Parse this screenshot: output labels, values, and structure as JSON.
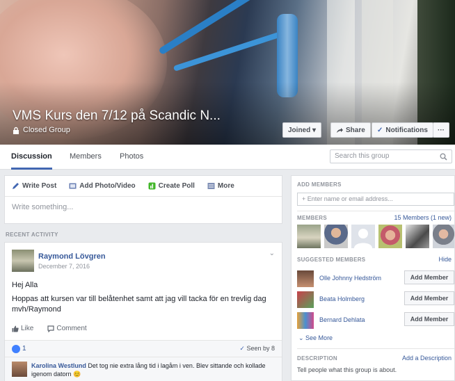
{
  "group": {
    "title": "VMS Kurs den 7/12 på Scandic N...",
    "privacy": "Closed Group",
    "buttons": {
      "joined": "Joined ▾",
      "share": "Share",
      "notifications": "Notifications",
      "more": "···"
    }
  },
  "tabs": [
    "Discussion",
    "Members",
    "Photos"
  ],
  "search": {
    "placeholder": "Search this group"
  },
  "composer": {
    "actions": [
      "Write Post",
      "Add Photo/Video",
      "Create Poll",
      "More"
    ],
    "placeholder": "Write something..."
  },
  "recent_activity_label": "RECENT ACTIVITY",
  "post": {
    "author": "Raymond Lövgren",
    "date": "December 7, 2016",
    "greeting": "Hej Alla",
    "body_line1": "Hoppas att kursen var till belåtenhet samt att jag vill tacka för en trevlig dag",
    "body_line2": "mvh/Raymond",
    "actions": {
      "like": "Like",
      "comment": "Comment"
    },
    "like_count": "1",
    "seen": "Seen by 8",
    "comment": {
      "author": "Karolina Westlund",
      "text": "Det tog nie extra lång tid i lagåm i ven. Blev sittande och kollade igenom datorn 😊"
    }
  },
  "sidebar": {
    "add_members_label": "ADD MEMBERS",
    "add_members_placeholder": "+ Enter name or email address...",
    "members_label": "MEMBERS",
    "members_count": "15 Members (1 new)",
    "suggested_label": "SUGGESTED MEMBERS",
    "hide": "Hide",
    "suggested": [
      {
        "name": "Olle Johnny Hedström",
        "button": "Add Member"
      },
      {
        "name": "Beata Holmberg",
        "button": "Add Member"
      },
      {
        "name": "Bernard Dehlata",
        "button": "Add Member"
      }
    ],
    "see_more": "See More",
    "description_label": "DESCRIPTION",
    "add_description": "Add a Description",
    "description_prompt": "Tell people what this group is about."
  },
  "colors": {
    "brand": "#4267b2",
    "link": "#365899",
    "bg": "#e9ebee"
  }
}
